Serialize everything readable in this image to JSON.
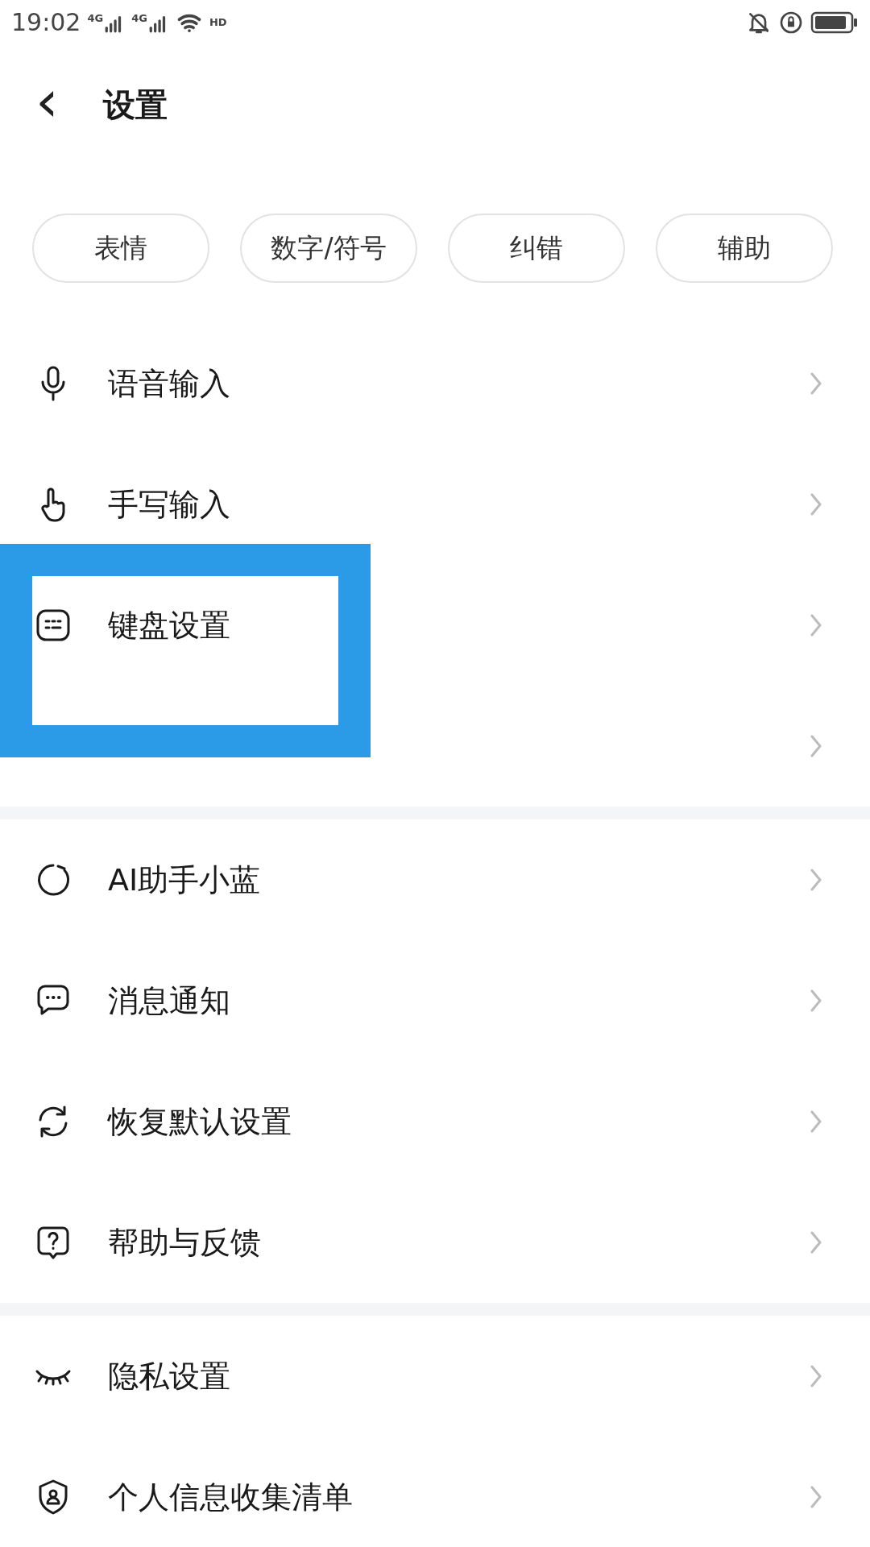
{
  "status_bar": {
    "time": "19:02",
    "network_labels": [
      "4G",
      "4G"
    ],
    "hd_label": "HD"
  },
  "header": {
    "back": "‹",
    "title": "设置"
  },
  "chips": [
    {
      "label": "表情"
    },
    {
      "label": "数字/符号"
    },
    {
      "label": "纠错"
    },
    {
      "label": "辅助"
    }
  ],
  "sections": [
    {
      "rows": [
        {
          "label": "语音输入"
        },
        {
          "label": "手写输入"
        },
        {
          "label": "键盘设置"
        },
        {}
      ]
    },
    {
      "rows": [
        {
          "label": "AI助手小蓝"
        },
        {
          "label": "消息通知"
        },
        {
          "label": "恢复默认设置"
        },
        {
          "label": "帮助与反馈"
        }
      ]
    },
    {
      "rows": [
        {
          "label": "隐私设置"
        },
        {
          "label": "个人信息收集清单"
        }
      ]
    }
  ],
  "annotation": {
    "kind": "frame"
  }
}
